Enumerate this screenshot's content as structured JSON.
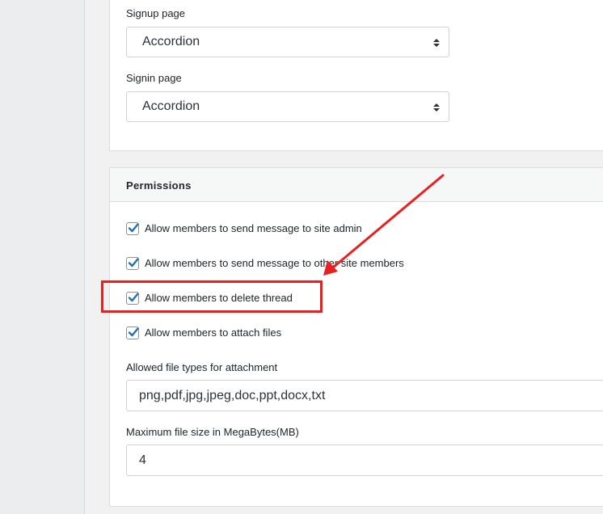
{
  "appearance": {
    "signup_label": "Signup page",
    "signup_value": "Accordion",
    "signin_label": "Signin page",
    "signin_value": "Accordion"
  },
  "permissions": {
    "title": "Permissions",
    "options": [
      {
        "label": "Allow members to send message to site admin",
        "checked": true
      },
      {
        "label": "Allow members to send message to other site members",
        "checked": true
      },
      {
        "label": "Allow members to delete thread",
        "checked": true
      },
      {
        "label": "Allow members to attach files",
        "checked": true
      }
    ],
    "file_types_label": "Allowed file types for attachment",
    "file_types_value": "png,pdf,jpg,jpeg,doc,ppt,docx,txt",
    "max_size_label": "Maximum file size in MegaBytes(MB)",
    "max_size_value": "4"
  },
  "colors": {
    "check_accent": "#2271b1",
    "annotation": "#e8201f"
  },
  "icons": {
    "select_arrows": "sort-arrows-icon",
    "checkmark": "checkmark-icon",
    "annotation_arrow": "red-arrow-icon"
  }
}
